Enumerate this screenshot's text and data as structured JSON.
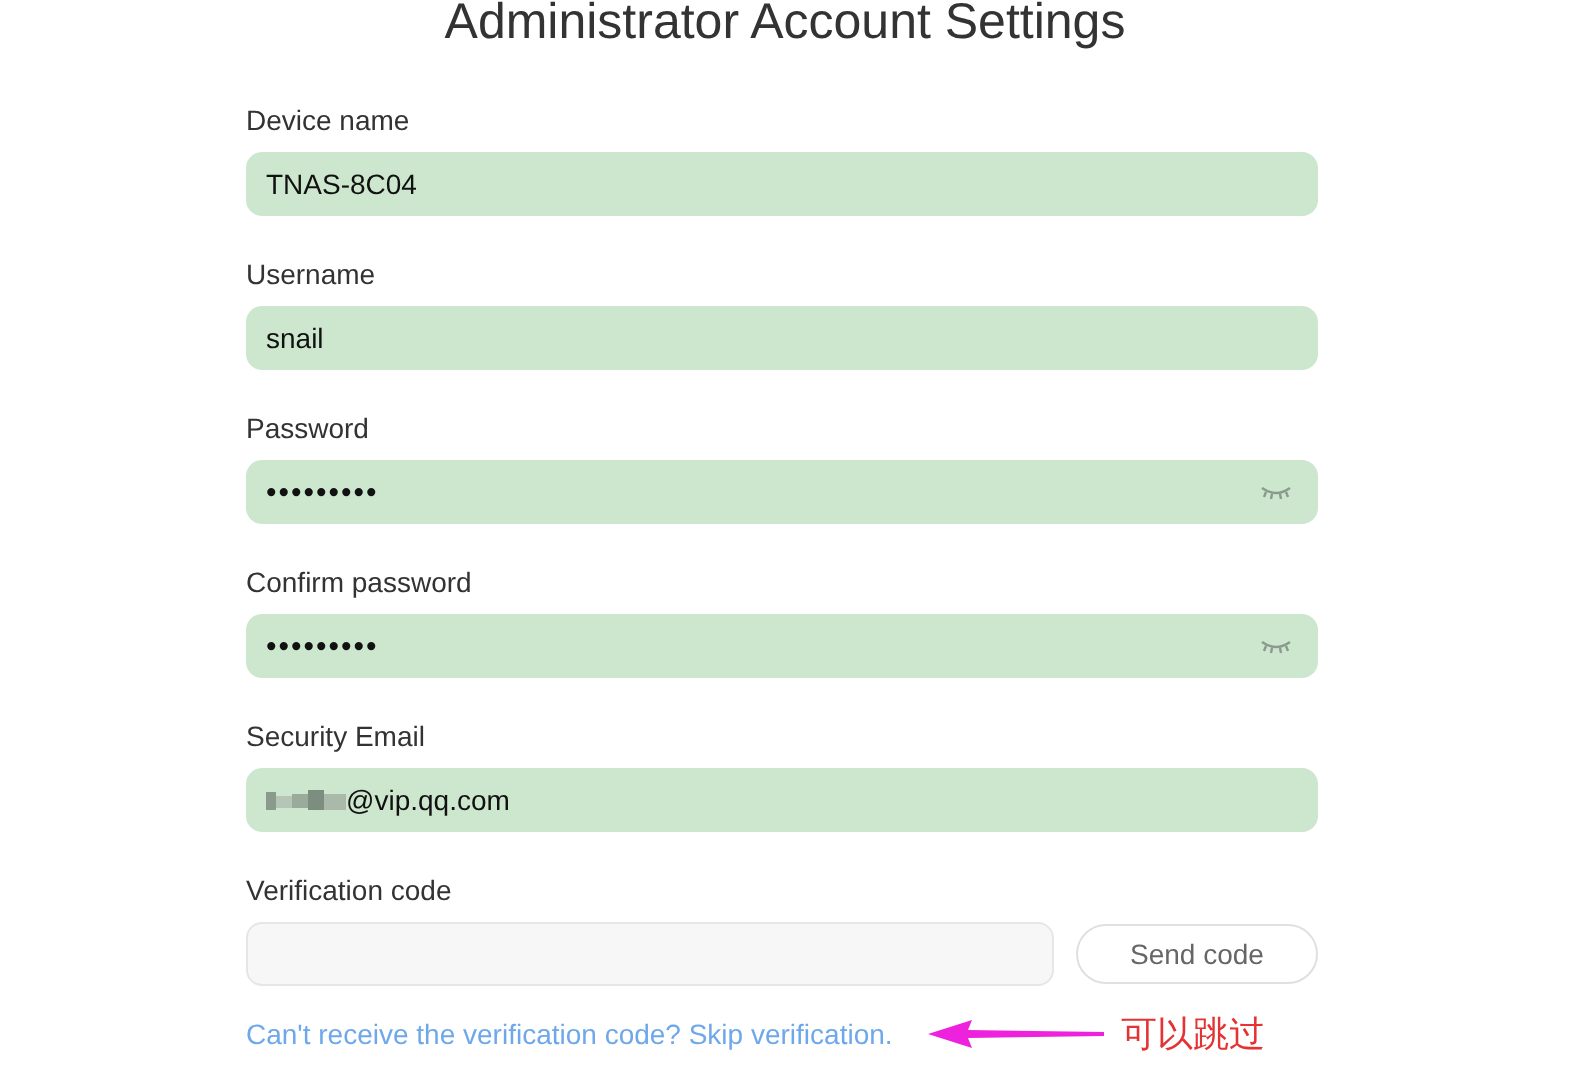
{
  "title": "Administrator Account Settings",
  "fields": [
    {
      "kind": "text",
      "label": "Device name",
      "value": "TNAS-8C04"
    },
    {
      "kind": "text",
      "label": "Username",
      "value": "snail"
    },
    {
      "kind": "password",
      "label": "Password",
      "value": "•••••••••"
    },
    {
      "kind": "password",
      "label": "Confirm password",
      "value": "•••••••••"
    },
    {
      "kind": "redacted",
      "label": "Security Email",
      "value": "@vip.qq.com"
    },
    {
      "kind": "code",
      "label": "Verification code",
      "button": "Send code"
    }
  ],
  "skip_link": "Can't receive the verification code? Skip verification.",
  "annotation": "可以跳过"
}
